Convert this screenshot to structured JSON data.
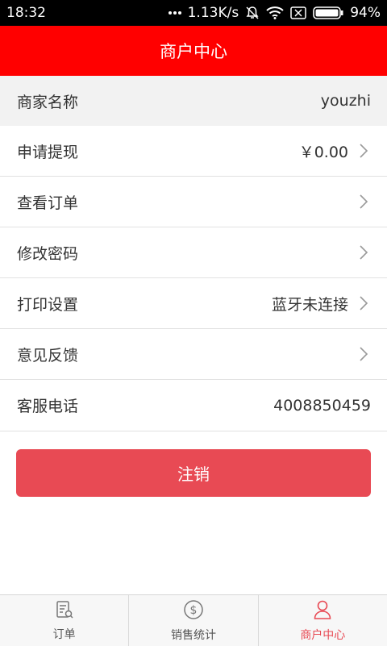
{
  "status_bar": {
    "time": "18:32",
    "network_speed": "1.13K/s",
    "battery": "94%"
  },
  "header": {
    "title": "商户中心"
  },
  "rows": {
    "merchant": {
      "label": "商家名称",
      "value": "youzhi"
    },
    "withdraw": {
      "label": "申请提现",
      "value": "￥0.00"
    },
    "orders": {
      "label": "查看订单"
    },
    "password": {
      "label": "修改密码"
    },
    "print": {
      "label": "打印设置",
      "value": "蓝牙未连接"
    },
    "feedback": {
      "label": "意见反馈"
    },
    "service": {
      "label": "客服电话",
      "value": "4008850459"
    }
  },
  "logout_label": "注销",
  "tabs": [
    {
      "label": "订单",
      "icon": "order-list-icon"
    },
    {
      "label": "销售统计",
      "icon": "dollar-circle-icon"
    },
    {
      "label": "商户中心",
      "icon": "user-icon",
      "active": true
    }
  ],
  "colors": {
    "header": "#ff0000",
    "accent": "#e84a54"
  }
}
